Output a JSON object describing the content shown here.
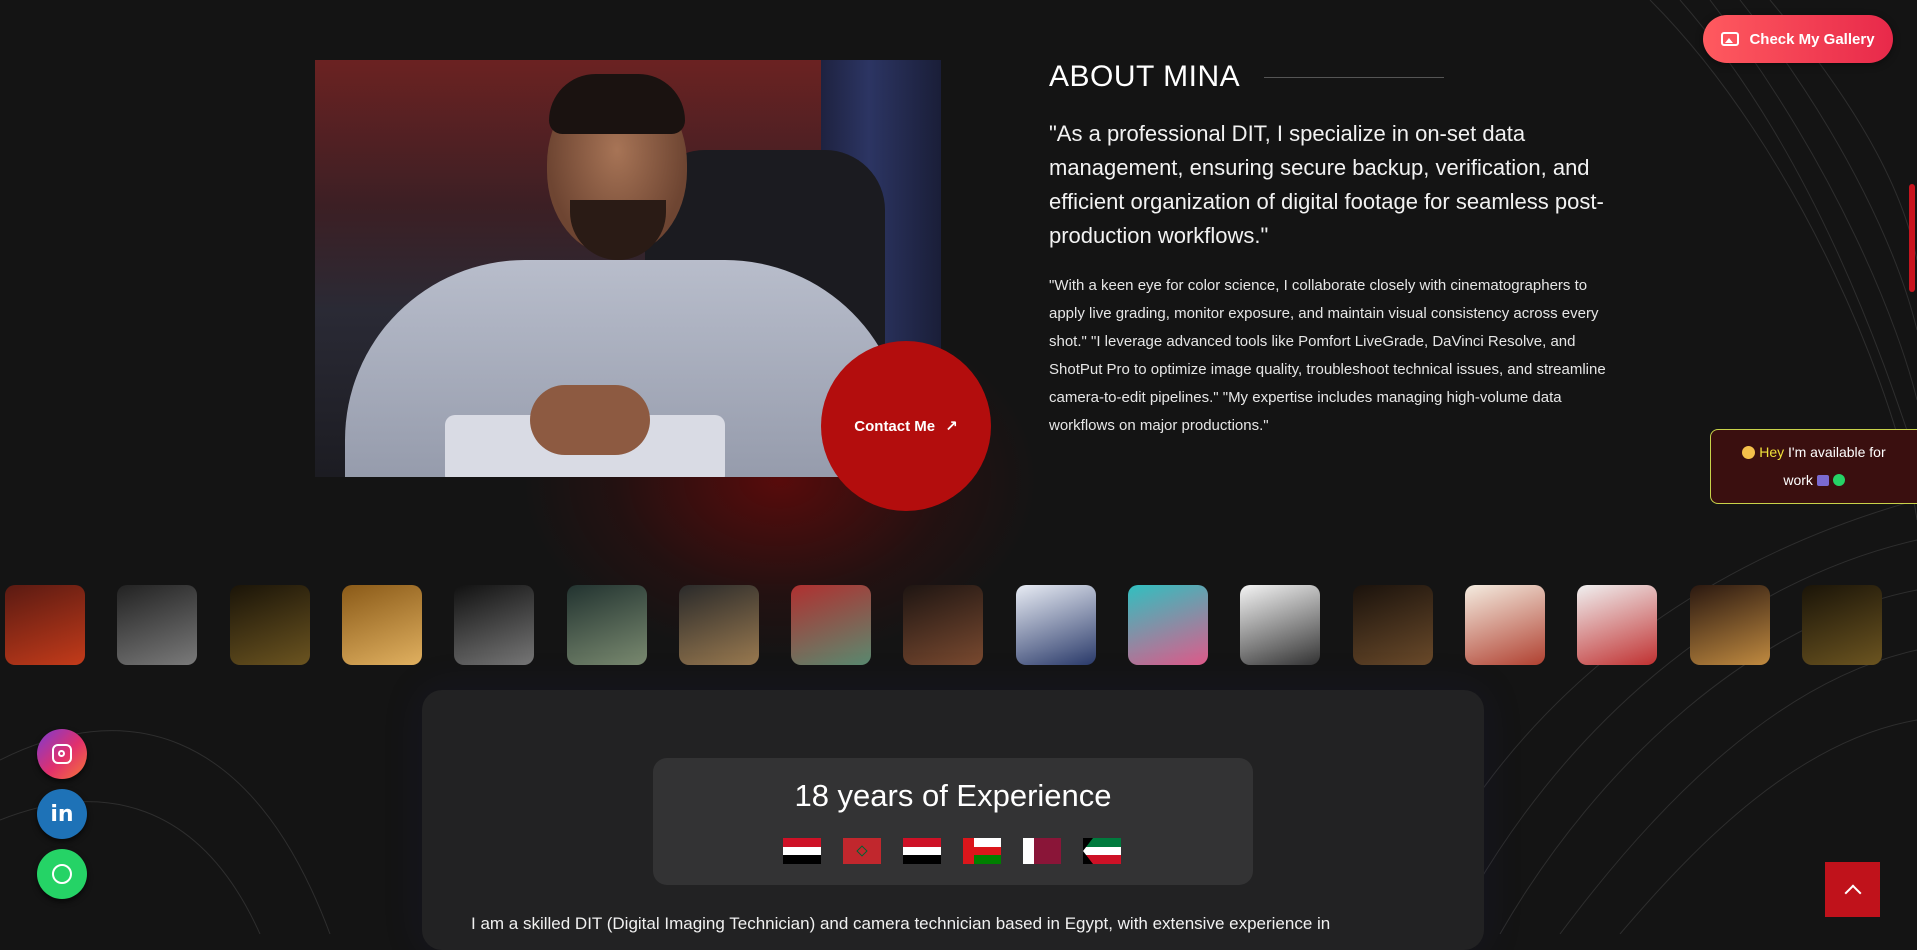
{
  "gallery_button": {
    "label": "Check My Gallery",
    "icon": "gallery-icon"
  },
  "about": {
    "title": "ABOUT MINA",
    "quote": "\"As a professional DIT, I specialize in on-set data management, ensuring secure backup, verification, and efficient organization of digital footage for seamless post-production workflows.\"",
    "description": "\"With a keen eye for color science, I collaborate closely with cinematographers to apply live grading, monitor exposure, and maintain visual consistency across every shot.\" \"I leverage advanced tools like Pomfort LiveGrade, DaVinci Resolve, and ShotPut Pro to optimize image quality, troubleshoot technical issues, and streamline camera-to-edit pipelines.\" \"My expertise includes managing high-volume data workflows on major productions.\""
  },
  "contact_button": {
    "label": "Contact Me",
    "arrow": "↗"
  },
  "availability": {
    "hey": "Hey",
    "line1": " I'm available for",
    "line2": "work"
  },
  "posters": [
    {
      "colors": [
        "#5a1a12",
        "#c33b1a"
      ]
    },
    {
      "colors": [
        "#222",
        "#7a7a7a"
      ]
    },
    {
      "colors": [
        "#1a1408",
        "#6b5420"
      ]
    },
    {
      "colors": [
        "#8a5a18",
        "#e0b060"
      ]
    },
    {
      "colors": [
        "#111",
        "#777"
      ]
    },
    {
      "colors": [
        "#223330",
        "#7a8a70"
      ]
    },
    {
      "colors": [
        "#2a2a2a",
        "#9a7a50"
      ]
    },
    {
      "colors": [
        "#b03030",
        "#5a8a70"
      ]
    },
    {
      "colors": [
        "#1e1512",
        "#7a4a30"
      ]
    },
    {
      "colors": [
        "#e8ecf4",
        "#2a3a6a"
      ]
    },
    {
      "colors": [
        "#30c0c0",
        "#e05a8a"
      ]
    },
    {
      "colors": [
        "#f4f4f4",
        "#333"
      ]
    },
    {
      "colors": [
        "#1a120c",
        "#6a4a2a"
      ]
    },
    {
      "colors": [
        "#f4ece0",
        "#b04030"
      ]
    },
    {
      "colors": [
        "#f0f0f0",
        "#c03030"
      ]
    },
    {
      "colors": [
        "#2a1810",
        "#c08a40"
      ]
    },
    {
      "colors": [
        "#1a1408",
        "#6b5420"
      ]
    }
  ],
  "experience": {
    "title": "18 years of Experience",
    "flags": [
      "egypt-flag",
      "morocco-flag",
      "yemen-flag",
      "oman-flag",
      "qatar-flag",
      "kuwait-flag"
    ]
  },
  "bio": "I am a skilled DIT (Digital Imaging Technician) and camera technician based in Egypt, with extensive experience in",
  "socials": [
    {
      "name": "instagram",
      "label": ""
    },
    {
      "name": "linkedin",
      "label": "in"
    },
    {
      "name": "whatsapp",
      "label": ""
    }
  ],
  "colors": {
    "accent": "#b30d0d",
    "gallery": "#ff5a5f",
    "available_border": "#c8d24a"
  }
}
